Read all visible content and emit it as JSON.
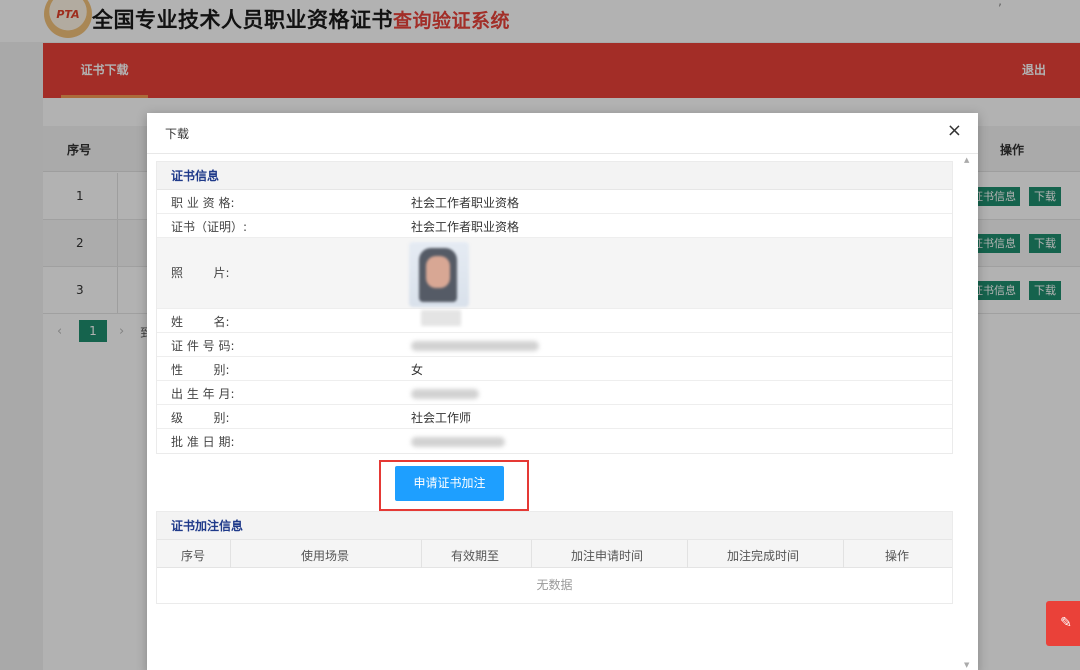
{
  "header": {
    "logo_text": "PTA",
    "title_main": "全国专业技术人员职业资格证书",
    "title_accent": "查询验证系统"
  },
  "nav": {
    "tab_download": "证书下载",
    "logout": "退出"
  },
  "background_table": {
    "col_seq": "序号",
    "col_op": "操作",
    "rows": [
      {
        "seq": "1",
        "info_btn": "证书信息",
        "download_btn": "下载"
      },
      {
        "seq": "2",
        "info_btn": "证书信息",
        "download_btn": "下载"
      },
      {
        "seq": "3",
        "info_btn": "证书信息",
        "download_btn": "下载"
      }
    ],
    "pager": {
      "current": "1",
      "tail": "到"
    }
  },
  "modal": {
    "title": "下载",
    "close_glyph": "×",
    "cert_section": {
      "heading": "证书信息",
      "rows": [
        {
          "label": "职 业 资 格:",
          "value": "社会工作者职业资格"
        },
        {
          "label": "证书（证明）:",
          "value": "社会工作者职业资格"
        },
        {
          "label": "照        片:",
          "value": ""
        },
        {
          "label": "姓        名:",
          "value": ""
        },
        {
          "label": "证 件 号 码:",
          "value": ""
        },
        {
          "label": "性        别:",
          "value": "女"
        },
        {
          "label": "出 生 年 月:",
          "value": ""
        },
        {
          "label": "级        别:",
          "value": "社会工作师"
        },
        {
          "label": "批 准 日 期:",
          "value": ""
        }
      ]
    },
    "apply_button": "申请证书加注",
    "annotation_section": {
      "heading": "证书加注信息",
      "columns": [
        "序号",
        "使用场景",
        "有效期至",
        "加注申请时间",
        "加注完成时间",
        "操作"
      ],
      "empty_text": "无数据"
    }
  },
  "colors": {
    "nav_red": "#ea4139",
    "action_green": "#1f8f6f",
    "apply_blue": "#1e9fff",
    "highlight_red": "#e53935"
  }
}
